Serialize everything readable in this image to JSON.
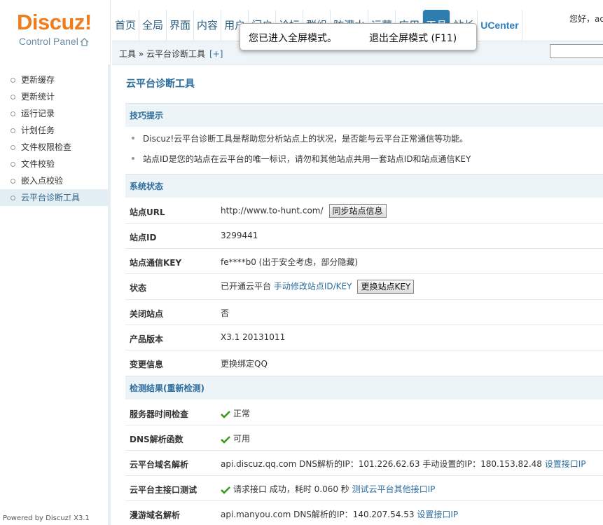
{
  "logo": {
    "brand": "Discuz!",
    "sub": "Control Panel"
  },
  "nav": [
    "首页",
    "全局",
    "界面",
    "内容",
    "用户",
    "门户",
    "论坛",
    "群组",
    "防灌水",
    "运营",
    "应用",
    "工具",
    "站长",
    "UCenter"
  ],
  "user": "您好，ad",
  "breadcrumb": {
    "text": "工具 » 云平台诊断工具",
    "add": "[+]"
  },
  "toast": {
    "msg": "您已进入全屏模式。",
    "exit": "退出全屏模式 (F11)"
  },
  "sidebar": [
    "更新缓存",
    "更新统计",
    "运行记录",
    "计划任务",
    "文件权限检查",
    "文件校验",
    "嵌入点校验",
    "云平台诊断工具"
  ],
  "powered": "Powered by Discuz! X3.1",
  "title": "云平台诊断工具",
  "tips_title": "技巧提示",
  "tips": [
    "Discuz!云平台诊断工具是帮助您分析站点上的状况，是否能与云平台正常通信等功能。",
    "站点ID是您的站点在云平台的唯一标识，请勿和其他站点共用一套站点ID和站点通信KEY"
  ],
  "status_title": "系统状态",
  "status": {
    "url_label": "站点URL",
    "url": "http://www.to-hunt.com/",
    "sync_btn": "同步站点信息",
    "id_label": "站点ID",
    "id": "3299441",
    "key_label": "站点通信KEY",
    "key": "fe****b0 (出于安全考虑，部分隐藏)",
    "state_label": "状态",
    "state": "已开通云平台",
    "state_link": "手动修改站点ID/KEY",
    "key_btn": "更换站点KEY",
    "close_label": "关闭站点",
    "close": "否",
    "ver_label": "产品版本",
    "ver": "X3.1 20131011",
    "chg_label": "变更信息",
    "chg_link": "更换绑定QQ"
  },
  "check_title": "检测结果(重新检测)",
  "check": {
    "time_label": "服务器时间检查",
    "time": "正常",
    "dns_label": "DNS解析函数",
    "dns": "可用",
    "domain_label": "云平台域名解析",
    "domain": "api.discuz.qq.com DNS解析的IP：101.226.62.63 手动设置的IP：180.153.82.48",
    "domain_link": "设置接口IP",
    "api_label": "云平台主接口测试",
    "api": "请求接口 成功，耗时 0.060 秒",
    "api_link": "测试云平台其他接口IP",
    "manyou_label": "漫游域名解析",
    "manyou": "api.manyou.com DNS解析的IP：140.207.54.53",
    "manyou_link": "设置接口IP"
  },
  "colors": {
    "accent": "#2e6e9e",
    "logo": "#f07c1c",
    "check": "#3a9a1f"
  }
}
